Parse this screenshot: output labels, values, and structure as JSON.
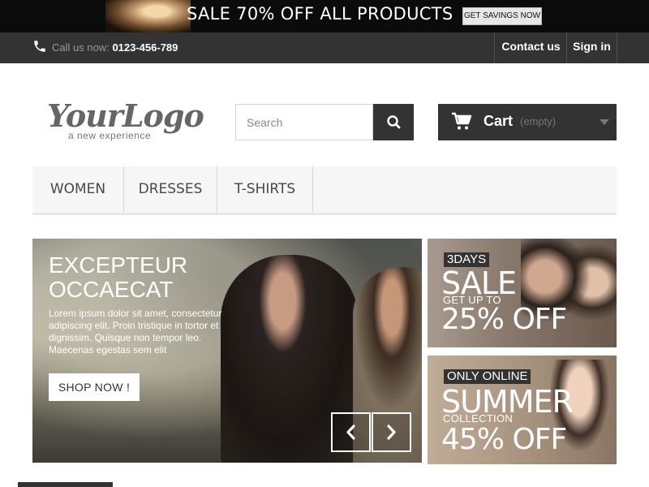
{
  "promo": {
    "title": "SALE 70% OFF ALL PRODUCTS",
    "button": "GET SAVINGS NOW"
  },
  "nav": {
    "call_label": "Call us now:",
    "phone": "0123-456-789",
    "contact": "Contact us",
    "signin": "Sign in"
  },
  "logo": {
    "main": "YourLogo",
    "sub": "a new experience"
  },
  "search": {
    "placeholder": "Search"
  },
  "cart": {
    "label": "Cart",
    "status": "(empty)"
  },
  "menu": {
    "items": [
      "WOMEN",
      "DRESSES",
      "T-SHIRTS"
    ]
  },
  "slider": {
    "title_line1": "EXCEPTEUR",
    "title_line2": "OCCAECAT",
    "text": "Lorem ipsum dolor sit amet, consectetur adipiscing elit. Proin tristique in tortor et dignissim. Quisque non tempor leo. Maecenas egestas sem elit",
    "button": "SHOP NOW !"
  },
  "banners": [
    {
      "tag": "3DAYS",
      "big": "SALE",
      "small": "GET UP TO",
      "pct": "25% OFF"
    },
    {
      "tag": "ONLY ONLINE",
      "big": "SUMMER",
      "small": "COLLECTION",
      "pct": "45% OFF"
    }
  ],
  "colors": {
    "dark": "#333333",
    "promo_bg": "#0b0b0b",
    "menu_bg": "#f6f6f6"
  }
}
